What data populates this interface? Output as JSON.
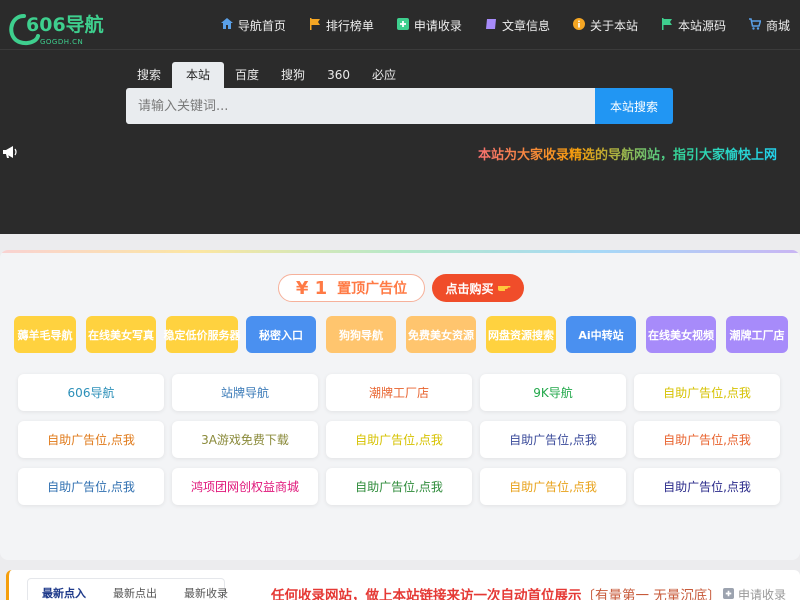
{
  "header": {
    "logo": {
      "text": "606导航",
      "sub": "GOGDH.CN"
    },
    "nav": [
      {
        "label": "导航首页",
        "icon": "home-icon"
      },
      {
        "label": "排行榜单",
        "icon": "flag-icon"
      },
      {
        "label": "申请收录",
        "icon": "plus-square-icon"
      },
      {
        "label": "文章信息",
        "icon": "book-icon"
      },
      {
        "label": "关于本站",
        "icon": "info-icon"
      },
      {
        "label": "本站源码",
        "icon": "flag-icon"
      },
      {
        "label": "商城",
        "icon": "cart-icon"
      }
    ]
  },
  "search": {
    "tabs": [
      "搜索",
      "本站",
      "百度",
      "搜狗",
      "360",
      "必应"
    ],
    "active_tab": "本站",
    "placeholder": "请输入关键词...",
    "button": "本站搜索"
  },
  "marquee": {
    "text": "本站为大家收录精选的导航网站，指引大家愉快上网"
  },
  "ad": {
    "num": "¥ 1",
    "label": "置顶广告位",
    "buy": "点击购买"
  },
  "chips": [
    {
      "label": "薅羊毛导航",
      "color": "#ffd23f"
    },
    {
      "label": "在线美女写真",
      "color": "#ffd23f"
    },
    {
      "label": "稳定低价服务器",
      "color": "#ffd23f"
    },
    {
      "label": "秘密入口",
      "color": "#4a90f0"
    },
    {
      "label": "狗狗导航",
      "color": "#ffc56e"
    },
    {
      "label": "免费美女资源",
      "color": "#ffc56e"
    },
    {
      "label": "网盘资源搜索",
      "color": "#ffd23f"
    },
    {
      "label": "Ai中转站",
      "color": "#4a90f0"
    },
    {
      "label": "在线美女视频",
      "color": "#a78bfa"
    },
    {
      "label": "潮牌工厂店",
      "color": "#a78bfa"
    }
  ],
  "grid": [
    [
      {
        "label": "606导航",
        "color": "#2b8fb8"
      },
      {
        "label": "站牌导航",
        "color": "#3b7bb8"
      },
      {
        "label": "潮牌工厂店",
        "color": "#e8622d"
      },
      {
        "label": "9K导航",
        "color": "#23a84b"
      },
      {
        "label": "自助广告位,点我",
        "color": "#d6c200"
      }
    ],
    [
      {
        "label": "自助广告位,点我",
        "color": "#e07a1a"
      },
      {
        "label": "3A游戏免费下载",
        "color": "#8a8a3a"
      },
      {
        "label": "自助广告位,点我",
        "color": "#d6c200"
      },
      {
        "label": "自助广告位,点我",
        "color": "#3a4a9a"
      },
      {
        "label": "自助广告位,点我",
        "color": "#e8622d"
      }
    ],
    [
      {
        "label": "自助广告位,点我",
        "color": "#2f6fb0"
      },
      {
        "label": "鸿项团网创权益商城",
        "color": "#e0157a"
      },
      {
        "label": "自助广告位,点我",
        "color": "#2e8b3a"
      },
      {
        "label": "自助广告位,点我",
        "color": "#e8a21a"
      },
      {
        "label": "自助广告位,点我",
        "color": "#2a2a8a"
      }
    ]
  ],
  "bottom": {
    "tabs": [
      "最新点入",
      "最新点出",
      "最新收录"
    ],
    "active_tab": "最新点入",
    "notice": "任何收录网站，做上本站链接来访一次自动首位展示",
    "notice_tail": "〔有量第一 无量沉底〕",
    "apply": "申请收录"
  }
}
